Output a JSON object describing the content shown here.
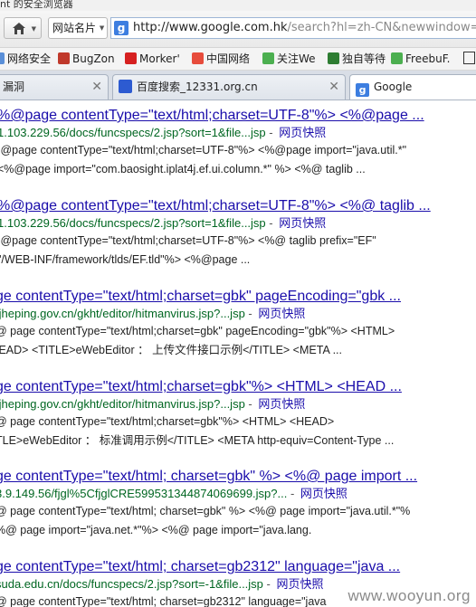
{
  "window": {
    "title": "nt 的安全浏览器"
  },
  "navbar": {
    "site_card_label": "网站名片",
    "url_domain": "http://www.google.com.hk",
    "url_path": "/search?hl=zh-CN&newwindow=1"
  },
  "bookmarks": [
    {
      "label": "网络安全",
      "icon_color": "#5a8fd8"
    },
    {
      "label": "BugZon",
      "icon_color": "#c0392b"
    },
    {
      "label": "Morker'",
      "icon_color": "#d62020"
    },
    {
      "label": "中国网络",
      "icon_color": "#e74c3c"
    },
    {
      "label": "关注We",
      "icon_color": "#4caf50"
    },
    {
      "label": "独自等待",
      "icon_color": "#2e7d32"
    },
    {
      "label": "FreebuF.",
      "icon_color": "#4caf50"
    }
  ],
  "tabs": [
    {
      "label": "漏洞",
      "active": false
    },
    {
      "label": "百度搜索_12331.org.cn",
      "active": false
    },
    {
      "label": "Google",
      "active": true
    }
  ],
  "results": [
    {
      "title": "%@page contentType=\"text/html;charset=UTF-8\"%> <%@page ...",
      "url": "1.103.229.56/docs/funcspecs/2.jsp?sort=1&file...jsp",
      "cache": "网页快照",
      "snippet": [
        ";@page contentType=\"text/html;charset=UTF-8\"%> <%@page import=\"java.util.*\"",
        "<%@page import=\"com.baosight.iplat4j.ef.ui.column.*\" %> <%@ taglib ..."
      ]
    },
    {
      "title": "%@page contentType=\"text/html;charset=UTF-8\"%> <%@ taglib ...",
      "url": "1.103.229.56/docs/funcspecs/2.jsp?sort=1&file...jsp",
      "cache": "网页快照",
      "snippet": [
        ";@page contentType=\"text/html;charset=UTF-8\"%> <%@ taglib prefix=\"EF\"",
        "\"/WEB-INF/framework/tlds/EF.tld\"%> <%@page ..."
      ]
    },
    {
      "title": "ge contentType=\"text/html;charset=gbk\" pageEncoding=\"gbk ...",
      "url": "tjheping.gov.cn/gkht/editor/hitmanvirus.jsp?...jsp",
      "cache": "网页快照",
      "snippet": [
        "@ page contentType=\"text/html;charset=gbk\" pageEncoding=\"gbk\"%> <HTML>",
        "IEAD> <TITLE>eWebEditor ： 上传文件接口示例</TITLE> <META ..."
      ]
    },
    {
      "title": "ge contentType=\"text/html;charset=gbk\"%> <HTML> <HEAD ...",
      "url": "tjheping.gov.cn/gkht/editor/hitmanvirus.jsp?...jsp",
      "cache": "网页快照",
      "snippet": [
        "@ page contentType=\"text/html;charset=gbk\"%> <HTML> <HEAD>",
        "TLE>eWebEditor ： 标准调用示例</TITLE> <META http-equiv=Content-Type ..."
      ]
    },
    {
      "title": "ge contentType=\"text/html; charset=gbk\" %> <%@ page import ...",
      "url": "3.9.149.56/fjgl%5CfjglCRE599531344874069699.jsp?...",
      "cache": "网页快照",
      "snippet": [
        "@ page contentType=\"text/html; charset=gbk\" %> <%@ page import=\"java.util.*\"%",
        "%@ page import=\"java.net.*\"%> <%@ page import=\"java.lang."
      ]
    },
    {
      "title": "ge contentType=\"text/html; charset=gb2312\" language=\"java ...",
      "url": "suda.edu.cn/docs/funcspecs/2.jsp?sort=-1&file...jsp",
      "cache": "网页快照",
      "snippet": [
        "@ page contentType=\"text/html; charset=gb2312\" language=\"java"
      ]
    }
  ],
  "watermark": "www.wooyun.org",
  "colors": {
    "link": "#1a0dab",
    "url_green": "#006621",
    "tab_bar": "#d9dee6"
  }
}
